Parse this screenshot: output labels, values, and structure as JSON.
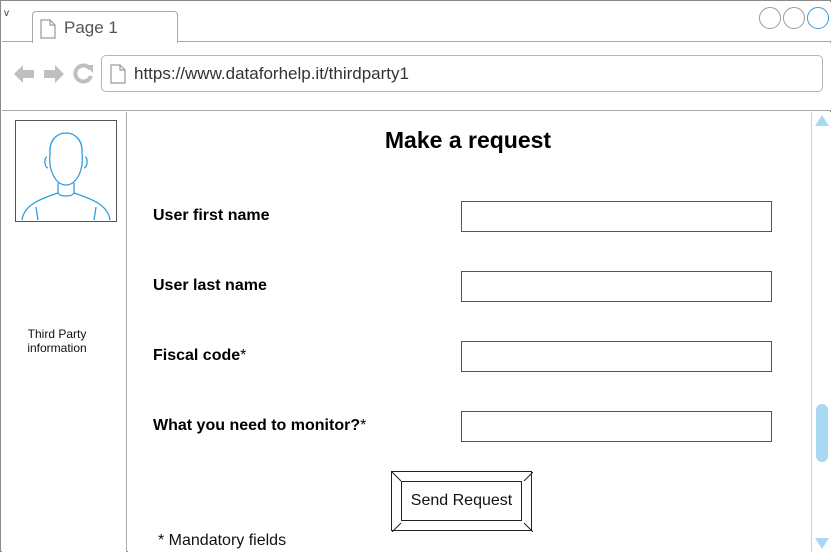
{
  "window": {
    "corner_mark": "v",
    "tab_label": "Page 1",
    "url": "https://www.dataforhelp.it/thirdparty1"
  },
  "sidebar": {
    "avatar_icon": "user-avatar-icon",
    "label_line1": "Third Party",
    "label_line2": "information"
  },
  "form": {
    "title": "Make a request",
    "fields": [
      {
        "label": "User first name",
        "required_mark": "",
        "value": ""
      },
      {
        "label": "User last name",
        "required_mark": "",
        "value": ""
      },
      {
        "label": "Fiscal code",
        "required_mark": "*",
        "value": ""
      },
      {
        "label": "What you need to monitor?",
        "required_mark": "*",
        "value": ""
      }
    ],
    "submit_label": "Send Request",
    "mandatory_note": "* Mandatory fields"
  },
  "colors": {
    "accent": "#2f9ce0",
    "scrollbar": "#a8d8f2",
    "border": "#a8a8a8"
  }
}
